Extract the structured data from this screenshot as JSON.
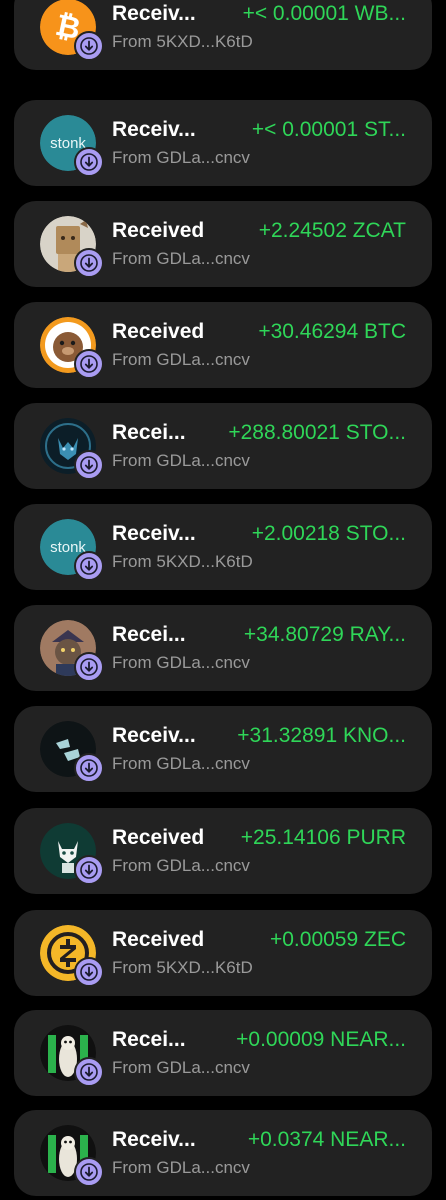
{
  "transactions": [
    {
      "title": "Receiv...",
      "amount": "+< 0.00001 WB...",
      "from": "From 5KXD...K6tD",
      "icon": "bitcoin-icon"
    },
    {
      "title": "Receiv...",
      "amount": "+< 0.00001 ST...",
      "from": "From GDLa...cncv",
      "icon": "stonk-icon",
      "icon_text": "stonk"
    },
    {
      "title": "Received",
      "amount": "+2.24502 ZCAT",
      "from": "From GDLa...cncv",
      "icon": "zcat-icon"
    },
    {
      "title": "Received",
      "amount": "+30.46294 BTC",
      "from": "From GDLa...cncv",
      "icon": "btc-monkey-icon"
    },
    {
      "title": "Recei...",
      "amount": "+288.80021 STO...",
      "from": "From GDLa...cncv",
      "icon": "sto-wolf-icon"
    },
    {
      "title": "Receiv...",
      "amount": "+2.00218 STO...",
      "from": "From 5KXD...K6tD",
      "icon": "stonk-icon",
      "icon_text": "stonk"
    },
    {
      "title": "Recei...",
      "amount": "+34.80729 RAY...",
      "from": "From GDLa...cncv",
      "icon": "ray-cat-icon"
    },
    {
      "title": "Receiv...",
      "amount": "+31.32891 KNO...",
      "from": "From GDLa...cncv",
      "icon": "kno-icon"
    },
    {
      "title": "Received",
      "amount": "+25.14106 PURR",
      "from": "From GDLa...cncv",
      "icon": "purr-icon"
    },
    {
      "title": "Received",
      "amount": "+0.00059 ZEC",
      "from": "From 5KXD...K6tD",
      "icon": "zcash-icon"
    },
    {
      "title": "Recei...",
      "amount": "+0.00009 NEAR...",
      "from": "From GDLa...cncv",
      "icon": "near-meerkat-icon"
    },
    {
      "title": "Receiv...",
      "amount": "+0.0374 NEAR...",
      "from": "From GDLa...cncv",
      "icon": "near-meerkat-icon"
    }
  ],
  "colors": {
    "background": "#000000",
    "card": "#222222",
    "amount_green": "#2fd658",
    "badge_purple": "#a99cf2",
    "subtext_gray": "#9a9a9a"
  },
  "badge_icon": "arrow-down-icon"
}
